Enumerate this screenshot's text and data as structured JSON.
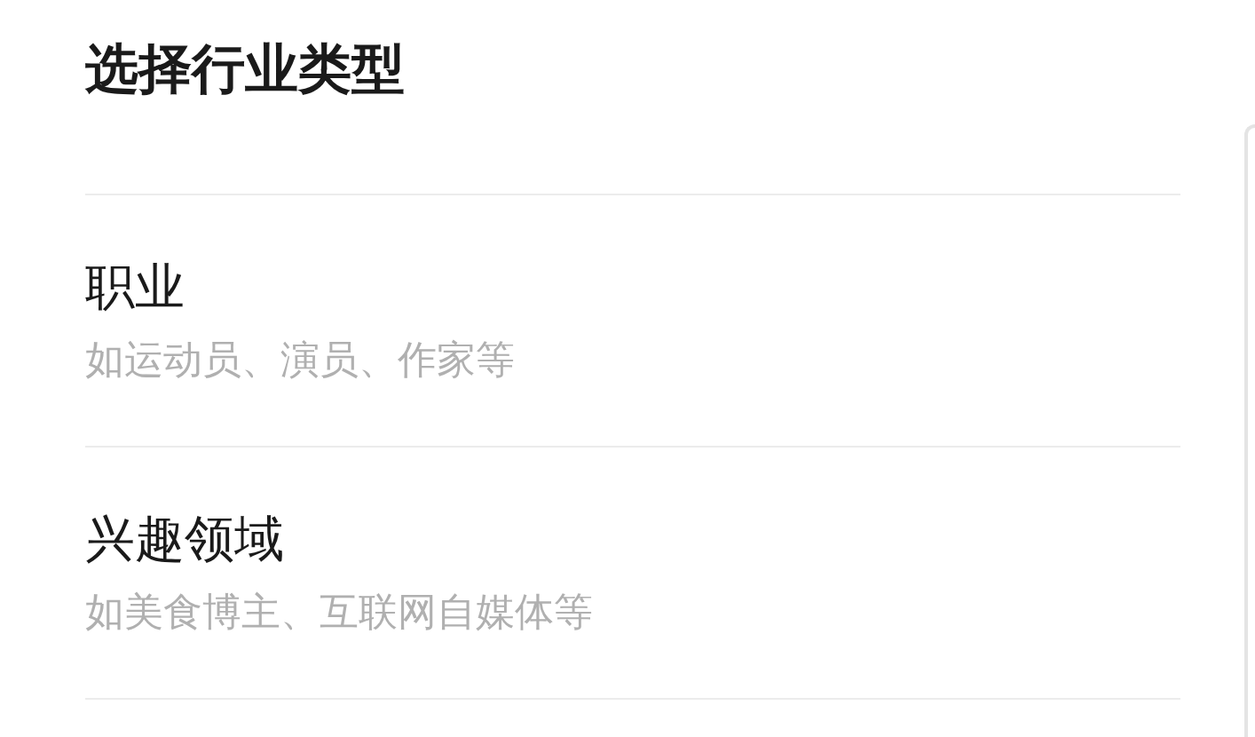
{
  "title": "选择行业类型",
  "options": [
    {
      "label": "职业",
      "description": "如运动员、演员、作家等"
    },
    {
      "label": "兴趣领域",
      "description": "如美食博主、互联网自媒体等"
    }
  ]
}
